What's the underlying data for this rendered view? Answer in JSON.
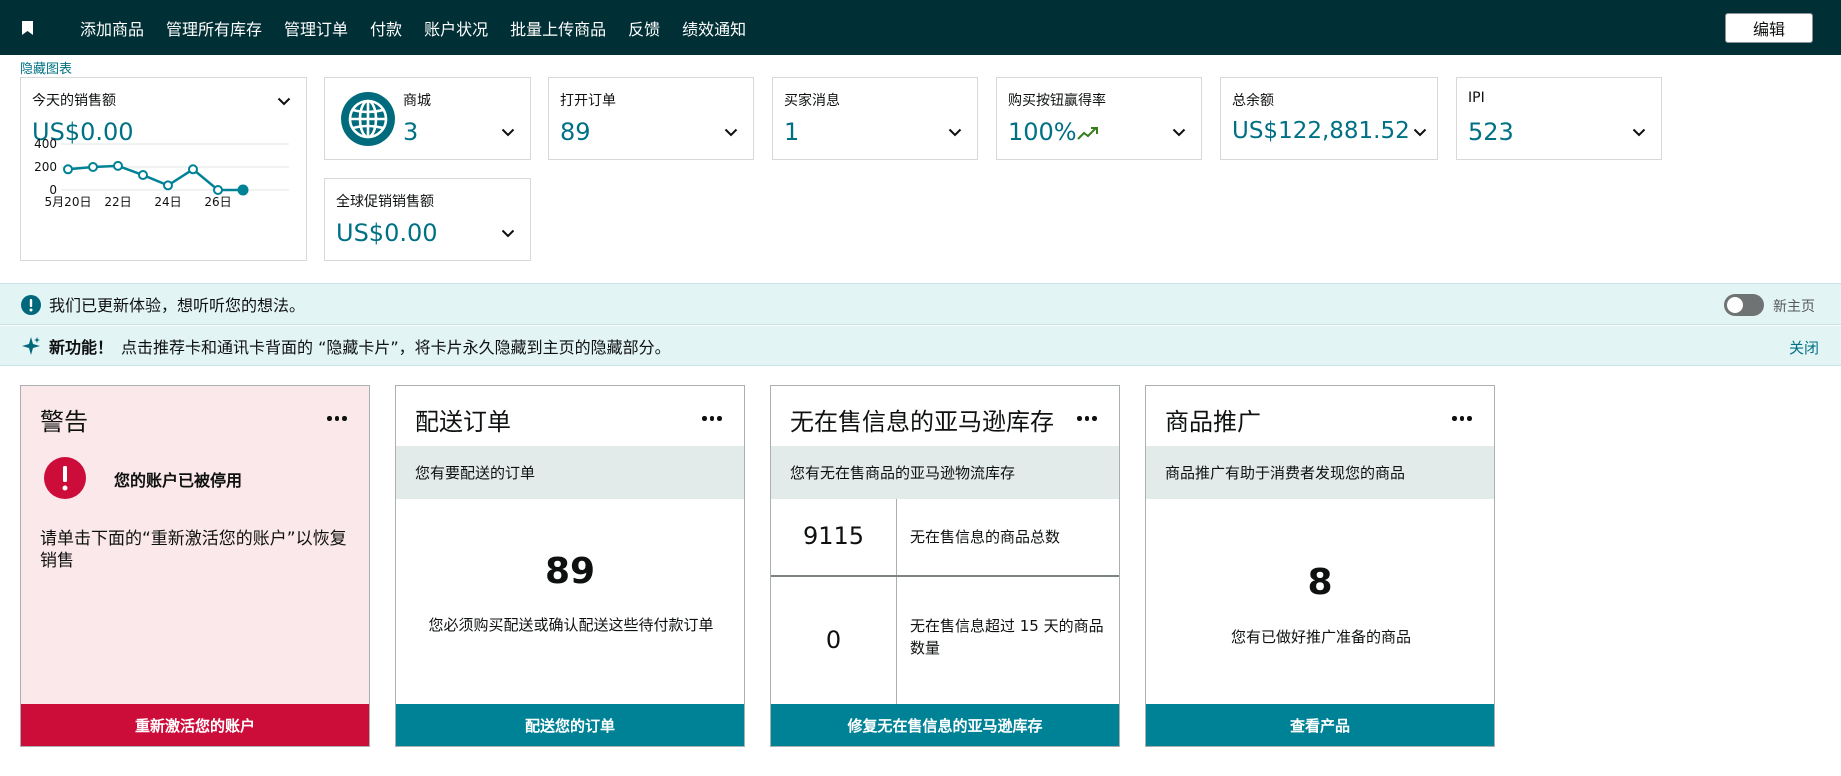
{
  "nav": {
    "items": [
      "添加商品",
      "管理所有库存",
      "管理订单",
      "付款",
      "账户状况",
      "批量上传商品",
      "反馈",
      "绩效通知"
    ],
    "edit_label": "编辑"
  },
  "hide_chart_link": "隐藏图表",
  "metrics": {
    "sales_today": {
      "label": "今天的销售额",
      "value": "US$0.00"
    },
    "store": {
      "label": "商城",
      "value": "3"
    },
    "open_orders": {
      "label": "打开订单",
      "value": "89"
    },
    "buyer_messages": {
      "label": "买家消息",
      "value": "1"
    },
    "buybox": {
      "label": "购买按钮赢得率",
      "value": "100%"
    },
    "total_balance": {
      "label": "总余额",
      "value": "US$122,881.52"
    },
    "ipi": {
      "label": "IPI",
      "value": "523"
    },
    "global_promo": {
      "label": "全球促销销售额",
      "value": "US$0.00"
    }
  },
  "chart_data": {
    "type": "line",
    "x": [
      "5月20日",
      "21日",
      "22日",
      "23日",
      "24日",
      "25日",
      "26日",
      "27日"
    ],
    "y": [
      180,
      200,
      210,
      130,
      40,
      180,
      0,
      0
    ],
    "xtick_labels": [
      "5月20日",
      "22日",
      "24日",
      "26日"
    ],
    "ytick_labels": [
      "400",
      "200",
      "0"
    ],
    "ylim": [
      0,
      400
    ],
    "grid": true,
    "color": "#008296"
  },
  "banners": {
    "feedback": "我们已更新体验，想听听您的想法。",
    "toggle_label": "新主页",
    "new_feature_bold": "新功能！",
    "new_feature_text": "点击推荐卡和通讯卡背面的 “隐藏卡片”，将卡片永久隐藏到主页的隐藏部分。",
    "close_label": "关闭"
  },
  "cards": {
    "warning": {
      "title": "警告",
      "heading": "您的账户已被停用",
      "body": "请单击下面的“重新激活您的账户”以恢复销售",
      "button": "重新激活您的账户"
    },
    "ship_orders": {
      "title": "配送订单",
      "subtitle": "您有要配送的订单",
      "number": "89",
      "desc": "您必须购买配送或确认配送这些待付款订单",
      "button": "配送您的订单"
    },
    "stranded": {
      "title": "无在售信息的亚马逊库存",
      "subtitle": "您有无在售商品的亚马逊物流库存",
      "rows": [
        {
          "value": "9115",
          "label": "无在售信息的商品总数"
        },
        {
          "value": "0",
          "label": "无在售信息超过 15 天的商品数量"
        }
      ],
      "button": "修复无在售信息的亚马逊库存"
    },
    "promotion": {
      "title": "商品推广",
      "subtitle": "商品推广有助于消费者发现您的商品",
      "number": "8",
      "desc": "您有已做好推广准备的商品",
      "button": "查看产品"
    }
  },
  "colors": {
    "nav_bg": "#002f36",
    "accent": "#007185",
    "button_teal": "#008296",
    "warning_red": "#cc0c39",
    "warning_bg": "#fbe8ea",
    "banner_bg": "#e3f4f5"
  }
}
